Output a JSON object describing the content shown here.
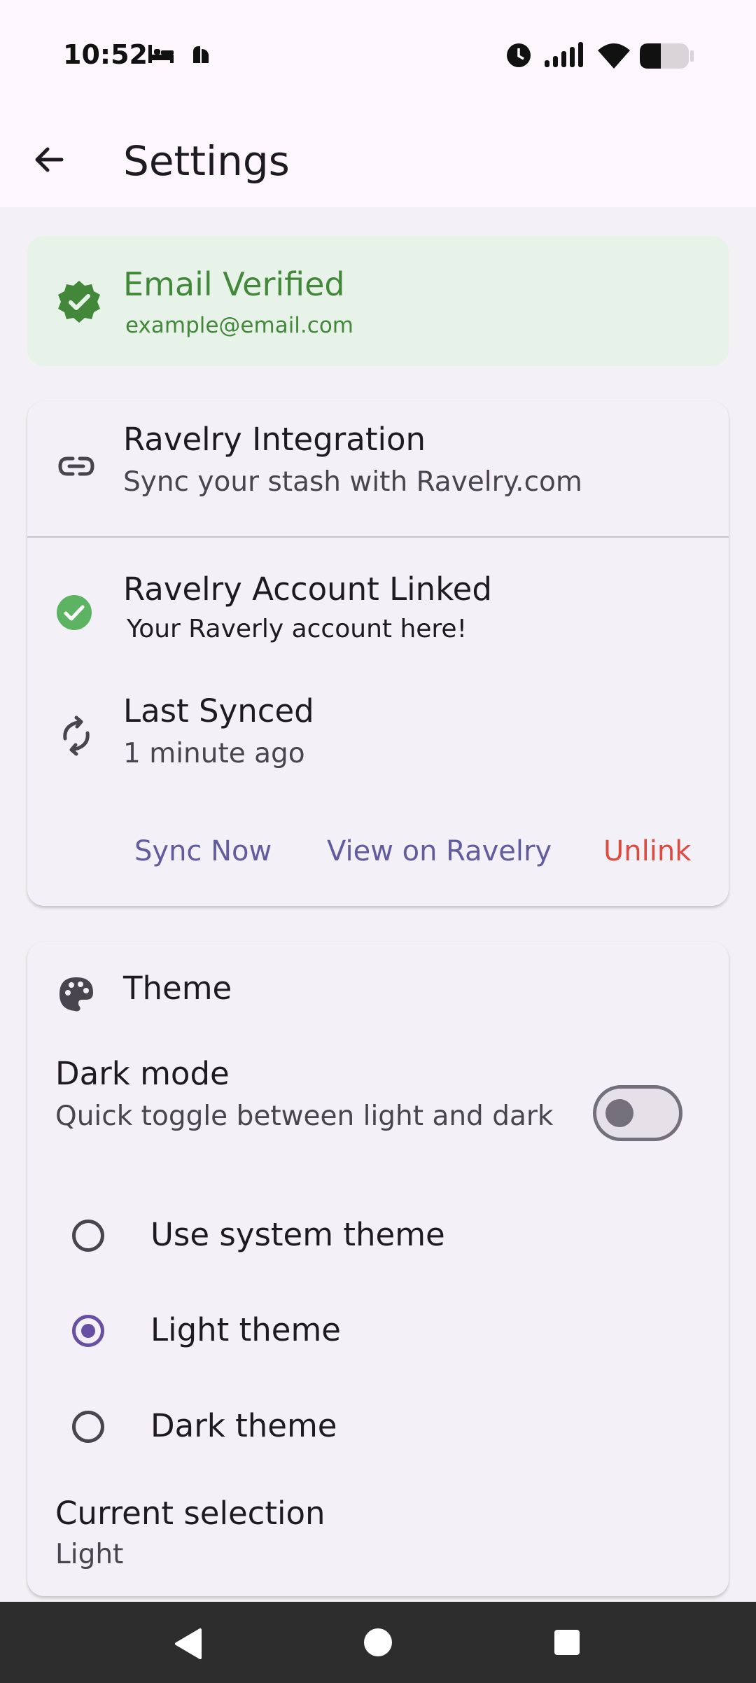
{
  "status_bar": {
    "time": "10:52"
  },
  "app_bar": {
    "title": "Settings"
  },
  "email": {
    "title": "Email Verified",
    "address": "example@email.com"
  },
  "ravelry": {
    "header_title": "Ravelry Integration",
    "header_subtitle": "Sync your stash with Ravelry.com",
    "linked_title": "Ravelry Account Linked",
    "linked_subtitle": "Your Raverly account here!",
    "synced_title": "Last Synced",
    "synced_subtitle": "1 minute ago",
    "actions": {
      "sync": "Sync Now",
      "view": "View on Ravelry",
      "unlink": "Unlink"
    }
  },
  "theme": {
    "header": "Theme",
    "dark_mode_title": "Dark mode",
    "dark_mode_subtitle": "Quick toggle between light and dark",
    "dark_mode_on": false,
    "options": [
      {
        "label": "Use system theme",
        "selected": false
      },
      {
        "label": "Light theme",
        "selected": true
      },
      {
        "label": "Dark theme",
        "selected": false
      }
    ],
    "current_title": "Current selection",
    "current_value": "Light"
  },
  "colors": {
    "accent": "#6750a4",
    "success": "#43873b",
    "danger": "#dc4b3f"
  }
}
